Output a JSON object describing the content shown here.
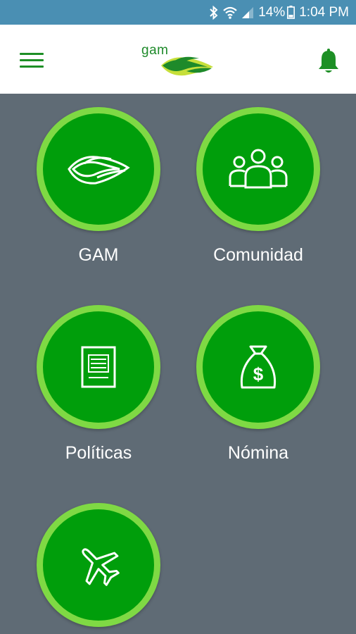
{
  "status_bar": {
    "battery": "14%",
    "time": "1:04 PM",
    "icons": [
      "bluetooth-icon",
      "wifi-icon",
      "signal-icon",
      "battery-icon"
    ]
  },
  "header": {
    "logo_text": "gam",
    "menu_icon": "hamburger-menu-icon",
    "notification_icon": "bell-icon"
  },
  "menu": {
    "items": [
      {
        "label": "GAM",
        "icon": "gam-logo-icon"
      },
      {
        "label": "Comunidad",
        "icon": "people-group-icon"
      },
      {
        "label": "Políticas",
        "icon": "document-icon"
      },
      {
        "label": "Nómina",
        "icon": "money-bag-icon"
      },
      {
        "label": "",
        "icon": "airplane-icon"
      }
    ]
  },
  "colors": {
    "status_bar": "#4a8fb3",
    "background": "#5f6b75",
    "tile_fill": "#009e0b",
    "tile_ring": "#7fd944",
    "accent": "#1d8f25"
  }
}
